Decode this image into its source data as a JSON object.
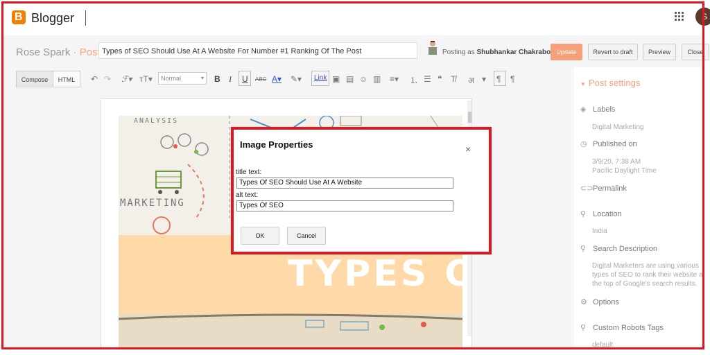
{
  "app": {
    "brand": "Blogger",
    "avatar_initial": "S"
  },
  "postbar": {
    "blog_name": "Rose Spark",
    "separator": "·",
    "section": "Post",
    "post_title": "Types of SEO Should Use At A Website For Number #1 Ranking Of The Post",
    "posting_as_prefix": "Posting as",
    "posting_as_name": "Shubhankar Chakraborty",
    "update_label": "Update",
    "revert_label": "Revert to draft",
    "preview_label": "Preview",
    "close_label": "Close"
  },
  "toolbar": {
    "compose_label": "Compose",
    "html_label": "HTML",
    "format_value": "Normal",
    "link_label": "Link"
  },
  "settings": {
    "heading": "Post settings",
    "items": [
      {
        "label": "Labels",
        "icon": "tag-icon",
        "value": "Digital Marketing"
      },
      {
        "label": "Published on",
        "icon": "clock-icon",
        "value": "3/9/20, 7:38 AM",
        "value2": "Pacific Daylight Time"
      },
      {
        "label": "Permalink",
        "icon": "link-icon"
      },
      {
        "label": "Location",
        "icon": "pin-icon",
        "value": "India"
      },
      {
        "label": "Search Description",
        "icon": "search-icon",
        "value": "Digital Marketers are using various types of SEO to rank their website at the top of Google's search results."
      },
      {
        "label": "Options",
        "icon": "gear-icon"
      },
      {
        "label": "Custom Robots Tags",
        "icon": "search-icon",
        "value": "default"
      }
    ]
  },
  "image": {
    "word_analysis": "ANALYSIS",
    "word_marketing": "MARKETING",
    "banner_text": "TYPES OF SI"
  },
  "dialog": {
    "title": "Image Properties",
    "close_glyph": "×",
    "title_text_label": "title text:",
    "title_text_value": "Types Of SEO Should Use At A Website",
    "alt_text_label": "alt text:",
    "alt_text_value": "Types Of SEO",
    "ok_label": "OK",
    "cancel_label": "Cancel"
  },
  "colors": {
    "accent": "#f6a07a",
    "frame": "#e0151f",
    "banner": "#ffd9a8"
  }
}
